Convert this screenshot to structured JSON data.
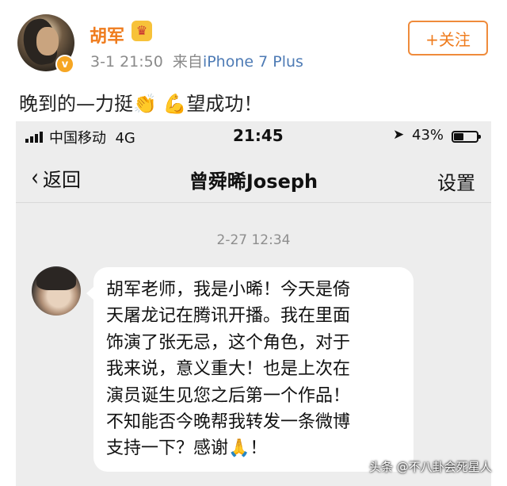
{
  "post": {
    "username": "胡军",
    "time": "3-1 21:50",
    "source_prefix": "来自",
    "source": "iPhone 7 Plus",
    "follow_label": "+关注",
    "text_before": "晚到的—力挺",
    "text_emoji": "👏 💪",
    "text_after": "望成功！",
    "icons": [
      "avatar",
      "verified-badge-icon",
      "vip-crown-icon"
    ]
  },
  "screenshot": {
    "status": {
      "carrier": "中国移动  4G",
      "time": "21:45",
      "location_icon": "➤",
      "battery_text": "43%",
      "battery_level": 0.43
    },
    "nav": {
      "back_label": "返回",
      "title": "曾舜晞Joseph",
      "settings_label": "设置"
    },
    "message": {
      "timestamp": "2-27 12:34",
      "lines": [
        "胡军老师，我是小晞！今天是倚",
        "天屠龙记在腾讯开播。我在里面",
        "饰演了张无忌，这个角色，对于",
        "我来说，意义重大！也是上次在",
        "演员诞生见您之后第一个作品！",
        "不知能否今晚帮我转发一条微博",
        "支持一下？感谢🙏！"
      ]
    }
  },
  "watermark": "头条 @不八卦会死星人",
  "colors": {
    "accent_orange": "#ef7b1c",
    "link_blue": "#4e7bb5",
    "chat_bg": "#ededed"
  }
}
